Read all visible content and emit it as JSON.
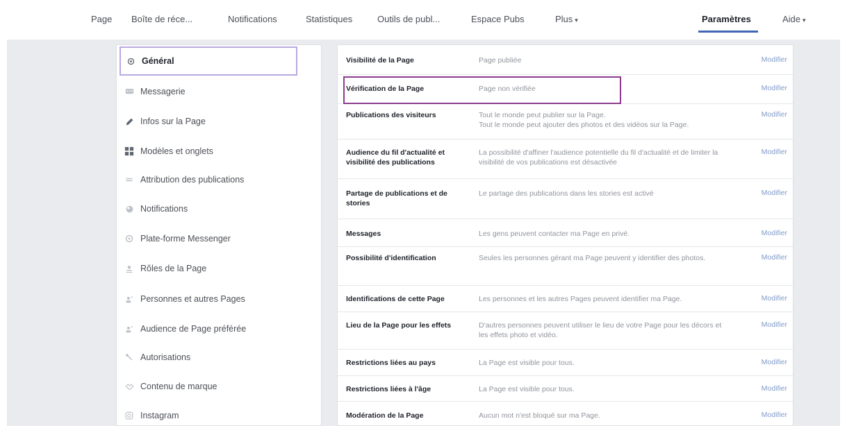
{
  "topnav": {
    "items": [
      {
        "label": "Page"
      },
      {
        "label": "Boîte de réce..."
      },
      {
        "label": "Notifications"
      },
      {
        "label": "Statistiques"
      },
      {
        "label": "Outils de publ..."
      },
      {
        "label": "Espace Pubs"
      },
      {
        "label": "Plus"
      },
      {
        "label": "Paramètres"
      },
      {
        "label": "Aide"
      }
    ],
    "active": "Paramètres",
    "accent_color": "#4267b2"
  },
  "sidebar": {
    "items": [
      {
        "label": "Général",
        "icon": "gear-icon"
      },
      {
        "label": "Messagerie",
        "icon": "chat-icon"
      },
      {
        "label": "Infos sur la Page",
        "icon": "pencil-icon"
      },
      {
        "label": "Modèles et onglets",
        "icon": "grid-icon"
      },
      {
        "label": "Attribution des publications",
        "icon": "flag-icon"
      },
      {
        "label": "Notifications",
        "icon": "globe-icon"
      },
      {
        "label": "Plate-forme Messenger",
        "icon": "messenger-icon"
      },
      {
        "label": "Rôles de la Page",
        "icon": "person-icon"
      },
      {
        "label": "Personnes et autres Pages",
        "icon": "people-icon"
      },
      {
        "label": "Audience de Page préférée",
        "icon": "people-star-icon"
      },
      {
        "label": "Autorisations",
        "icon": "wrench-icon"
      },
      {
        "label": "Contenu de marque",
        "icon": "handshake-icon"
      },
      {
        "label": "Instagram",
        "icon": "instagram-icon"
      }
    ],
    "selected": "Général",
    "selected_border_color": "#b9a9e0"
  },
  "settings": {
    "edit_label": "Modifier",
    "rows": [
      {
        "label": "Visibilité de la Page",
        "desc": "Page publiée"
      },
      {
        "label": "Vérification de la Page",
        "desc": "Page non vérifiée"
      },
      {
        "label": "Publications des visiteurs",
        "desc": "Tout le monde peut publier sur la Page.",
        "desc2": "Tout le monde peut ajouter des photos et des vidéos sur la Page."
      },
      {
        "label": "Audience du fil d'actualité et visibilité des publications",
        "desc": "La possibilité d'affiner l'audience potentielle du fil d'actualité et de limiter la visibilité de vos publications est désactivée"
      },
      {
        "label": "Partage de publications et de stories",
        "desc": "Le partage des publications dans les stories est activé"
      },
      {
        "label": "Messages",
        "desc": "Les gens peuvent contacter ma Page en privé."
      },
      {
        "label": "Possibilité d'identification",
        "desc": "Seules les personnes gérant ma Page peuvent y identifier des photos."
      },
      {
        "label": "Identifications de cette Page",
        "desc": "Les personnes et les autres Pages peuvent identifier ma Page."
      },
      {
        "label": "Lieu de la Page pour les effets",
        "desc": "D'autres personnes peuvent utiliser le lieu de votre Page pour les décors et les effets photo et vidéo."
      },
      {
        "label": "Restrictions liées au pays",
        "desc": "La Page est visible pour tous."
      },
      {
        "label": "Restrictions liées à l'âge",
        "desc": "La Page est visible pour tous."
      },
      {
        "label": "Modération de la Page",
        "desc": "Aucun mot n'est bloqué sur ma Page."
      }
    ],
    "highlight_color": "#8b3a8c"
  }
}
